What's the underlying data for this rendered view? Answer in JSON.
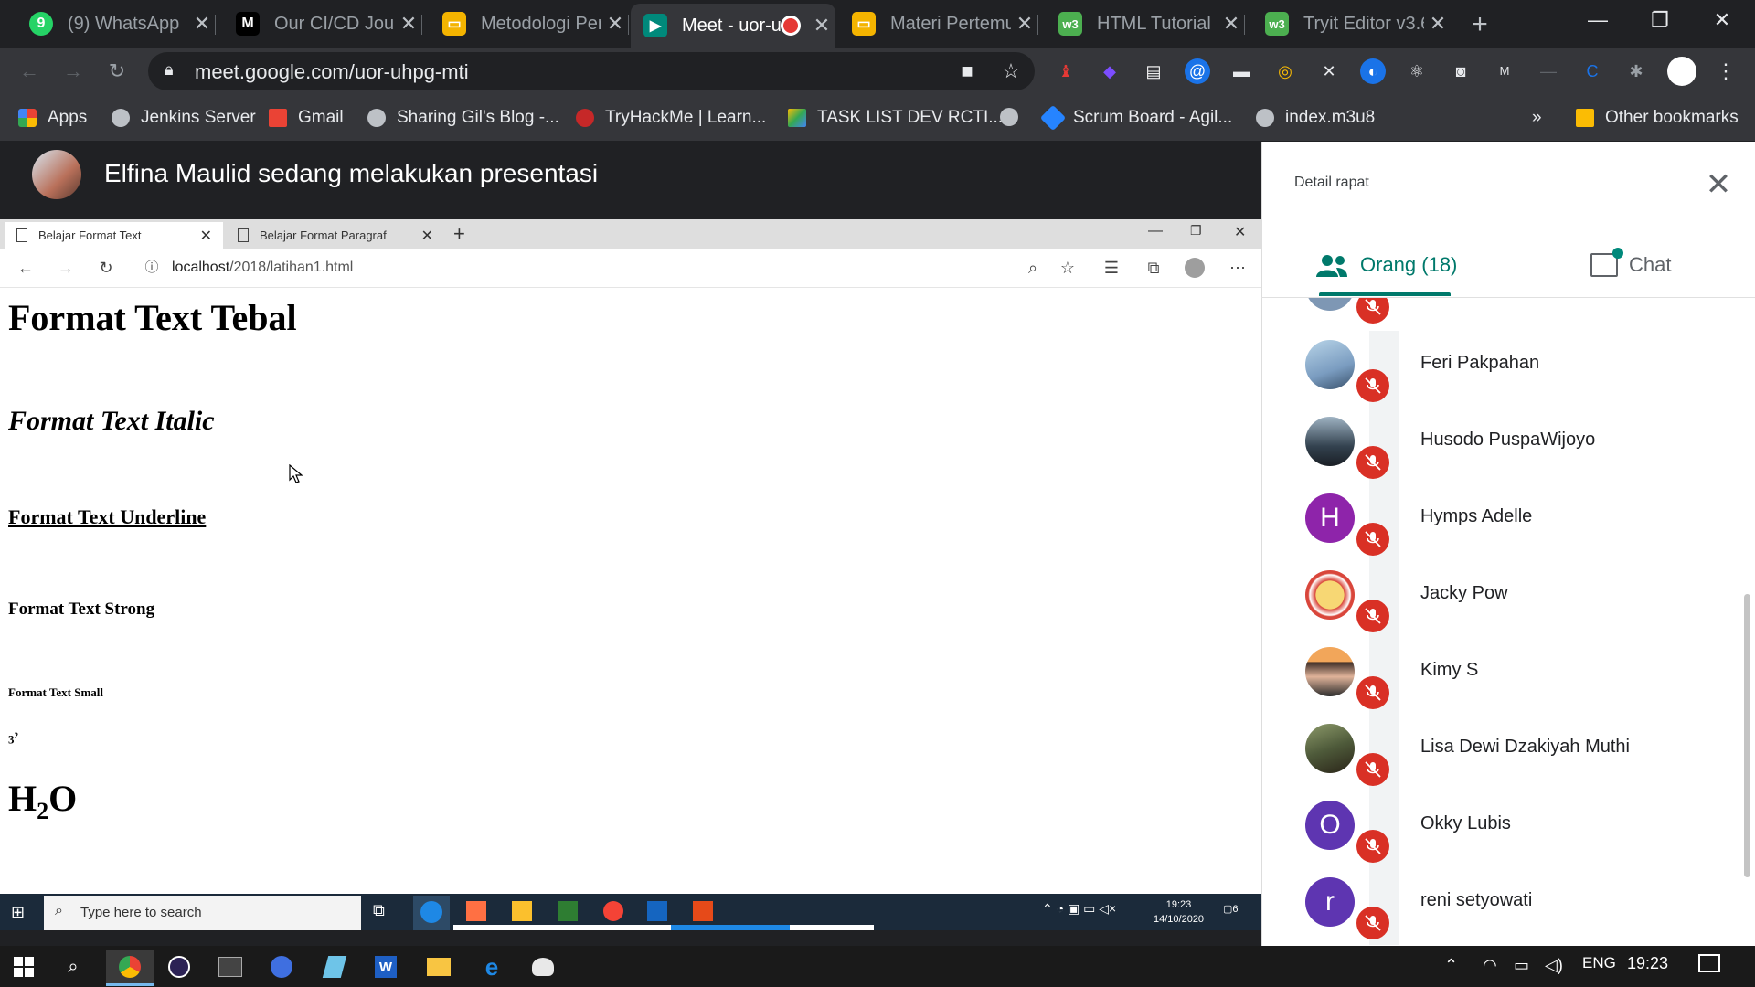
{
  "browser": {
    "tabs": [
      {
        "title": "(9) WhatsApp",
        "icon": "whatsapp-icon",
        "color": "#25d366"
      },
      {
        "title": "Our CI/CD Journ",
        "icon": "medium-icon",
        "color": "#000000"
      },
      {
        "title": "Metodologi Pen",
        "icon": "slides-icon",
        "color": "#f4b400"
      },
      {
        "title": "Meet - uor-u",
        "icon": "meet-icon",
        "color": "#00897b"
      },
      {
        "title": "Materi Pertemu",
        "icon": "slides-icon",
        "color": "#f4b400"
      },
      {
        "title": "HTML Tutorial",
        "icon": "w3schools-icon",
        "color": "#4caf50"
      },
      {
        "title": "Tryit Editor v3.6",
        "icon": "w3schools-icon",
        "color": "#4caf50"
      }
    ],
    "url": "meet.google.com/uor-uhpg-mti",
    "bookmarks": [
      "Apps",
      "Jenkins Server",
      "Gmail",
      "Sharing Gil's Blog -...",
      "TryHackMe | Learn...",
      "TASK LIST DEV RCTI...",
      "Scrum Board - Agil...",
      "index.m3u8",
      "Other bookmarks"
    ],
    "overflow": "»"
  },
  "meet": {
    "presenting_text": "Elfina Maulid sedang melakukan presentasi"
  },
  "shared_screen": {
    "tabs": [
      "Belajar Format Text",
      "Belajar Format Paragraf"
    ],
    "url_host": "localhost",
    "url_path": "/2018/latihan1.html",
    "content": {
      "bold": "Format Text Tebal",
      "italic": "Format Text Italic",
      "underline": "Format Text Underline",
      "strong": "Format Text Strong",
      "small": "Format Text Small",
      "sup_base": "3",
      "sup_exp": "2",
      "sub_a": "H",
      "sub_sub": "2",
      "sub_b": "O"
    },
    "taskbar": {
      "search_placeholder": "Type here to search",
      "time": "19:23",
      "date": "14/10/2020",
      "notif_count": "6"
    }
  },
  "panel": {
    "title": "Detail rapat",
    "people_tab": "Orang (18)",
    "chat_tab": "Chat",
    "participants": [
      {
        "name": "Feri Pakpahan",
        "avatar": "photo",
        "color": "#7a9cc0"
      },
      {
        "name": "Husodo PuspaWijoyo",
        "avatar": "photo",
        "color": "#33424f"
      },
      {
        "name": "Hymps Adelle",
        "avatar": "H",
        "color": "#8e24aa"
      },
      {
        "name": "Jacky Pow",
        "avatar": "photo",
        "color": "#d9463b"
      },
      {
        "name": "Kimy S",
        "avatar": "photo",
        "color": "#b87a5a"
      },
      {
        "name": "Lisa Dewi Dzakiyah Muthi",
        "avatar": "photo",
        "color": "#4e5a3a"
      },
      {
        "name": "Okky Lubis",
        "avatar": "O",
        "color": "#5e35b1"
      },
      {
        "name": "reni setyowati",
        "avatar": "r",
        "color": "#5e35b1"
      }
    ]
  },
  "windows": {
    "lang": "ENG",
    "time": "19:23"
  }
}
